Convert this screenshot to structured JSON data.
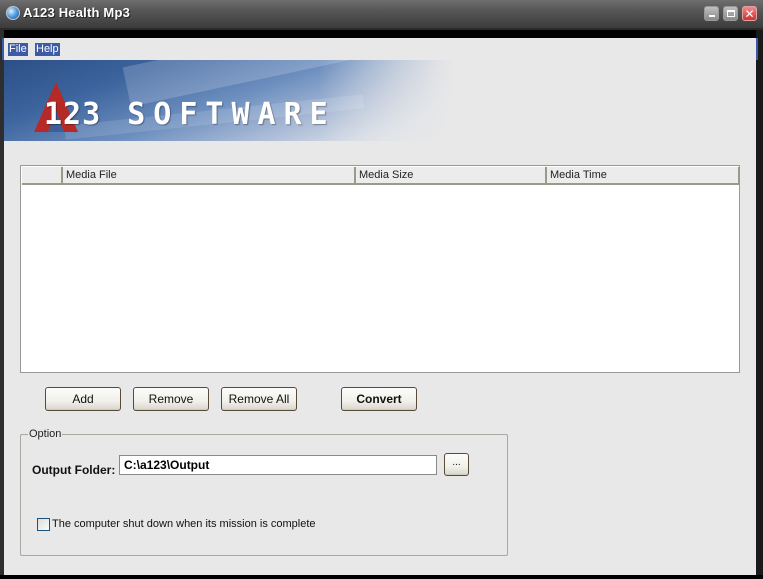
{
  "window": {
    "title": "A123 Health Mp3",
    "controls": {
      "minimize": "minimize",
      "maximize": "maximize",
      "close": "✕"
    }
  },
  "menu": {
    "items": [
      {
        "label": "File"
      },
      {
        "label": "Help"
      }
    ]
  },
  "banner": {
    "logo_letter": "A",
    "logo_number": "123",
    "logo_word": "SOFTWARE"
  },
  "media_list": {
    "columns": [
      {
        "label": ""
      },
      {
        "label": "Media File"
      },
      {
        "label": "Media Size"
      },
      {
        "label": "Media Time"
      }
    ],
    "rows": []
  },
  "actions": {
    "add": "Add",
    "remove": "Remove",
    "remove_all": "Remove All",
    "convert": "Convert"
  },
  "option": {
    "group_label": "Option",
    "output_folder_label": "Output Folder:",
    "output_folder_value": "C:\\a123\\Output",
    "browse_label": "...",
    "shutdown_label": "The computer shut down when its mission is complete",
    "shutdown_checked": false
  }
}
